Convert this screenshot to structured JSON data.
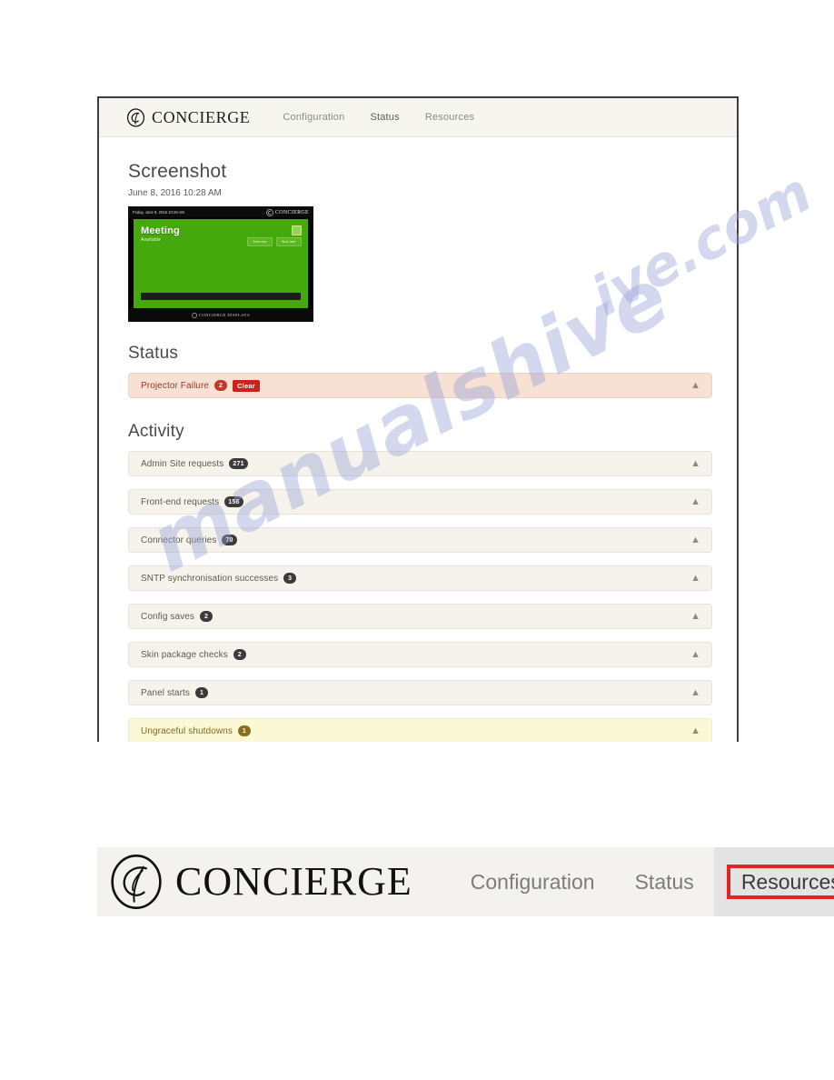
{
  "app": {
    "brand_name": "CONCIERGE",
    "logo_icon": "concierge-circle-c-logo"
  },
  "top_panel": {
    "nav": {
      "tabs": [
        {
          "label": "Configuration",
          "active": false
        },
        {
          "label": "Status",
          "active": true
        },
        {
          "label": "Resources",
          "active": false
        }
      ]
    },
    "screenshot_section": {
      "heading": "Screenshot",
      "timestamp": "June 8, 2016 10:28 AM",
      "device_preview": {
        "header_date": "Friday, June 8, 2016 10:28 AM",
        "header_brand": "CONCIERGE",
        "room_title": "Meeting",
        "room_status": "Available",
        "buttons": [
          {
            "label": "Book now"
          },
          {
            "label": "Book later"
          }
        ],
        "corner_icon": "signal-icon",
        "footer_brand": "CONCIERGE DISPLAYS",
        "background_color": "#45a80d"
      }
    },
    "status_section": {
      "heading": "Status",
      "rows": [
        {
          "label": "Projector Failure",
          "count": "2",
          "action_label": "Clear",
          "tone": "alert",
          "collapse_icon": "chevron-up-icon"
        }
      ]
    },
    "activity_section": {
      "heading": "Activity",
      "rows": [
        {
          "label": "Admin Site requests",
          "count": "271",
          "tone": "default",
          "collapse_icon": "chevron-up-icon"
        },
        {
          "label": "Front-end requests",
          "count": "158",
          "tone": "default",
          "collapse_icon": "chevron-up-icon"
        },
        {
          "label": "Connector queries",
          "count": "70",
          "tone": "default",
          "collapse_icon": "chevron-up-icon"
        },
        {
          "label": "SNTP synchronisation successes",
          "count": "3",
          "tone": "default",
          "collapse_icon": "chevron-up-icon"
        },
        {
          "label": "Config saves",
          "count": "2",
          "tone": "default",
          "collapse_icon": "chevron-up-icon"
        },
        {
          "label": "Skin package checks",
          "count": "2",
          "tone": "default",
          "collapse_icon": "chevron-up-icon"
        },
        {
          "label": "Panel starts",
          "count": "1",
          "tone": "default",
          "collapse_icon": "chevron-up-icon"
        },
        {
          "label": "Ungraceful shutdowns",
          "count": "1",
          "tone": "warn",
          "collapse_icon": "chevron-up-icon"
        }
      ]
    }
  },
  "zoom_callout": {
    "brand_name": "CONCIERGE",
    "tabs": [
      {
        "label": "Configuration",
        "highlighted": false
      },
      {
        "label": "Status",
        "highlighted": false
      },
      {
        "label": "Resources",
        "highlighted": true
      }
    ],
    "highlight_color": "#e52421"
  },
  "watermark": {
    "line_a": "ive.com",
    "line_b": "manualshive"
  },
  "colors": {
    "alert_bg": "#f7e0d4",
    "alert_text": "#9c3a2d",
    "warn_bg": "#fbf8d6",
    "row_bg": "#f5f3eb",
    "badge_dark": "#3b3b3b",
    "badge_red": "#c0392b",
    "badge_gold": "#8a6d1d",
    "clear_button": "#c9241b",
    "active_tab_bg": "#eceades"
  }
}
